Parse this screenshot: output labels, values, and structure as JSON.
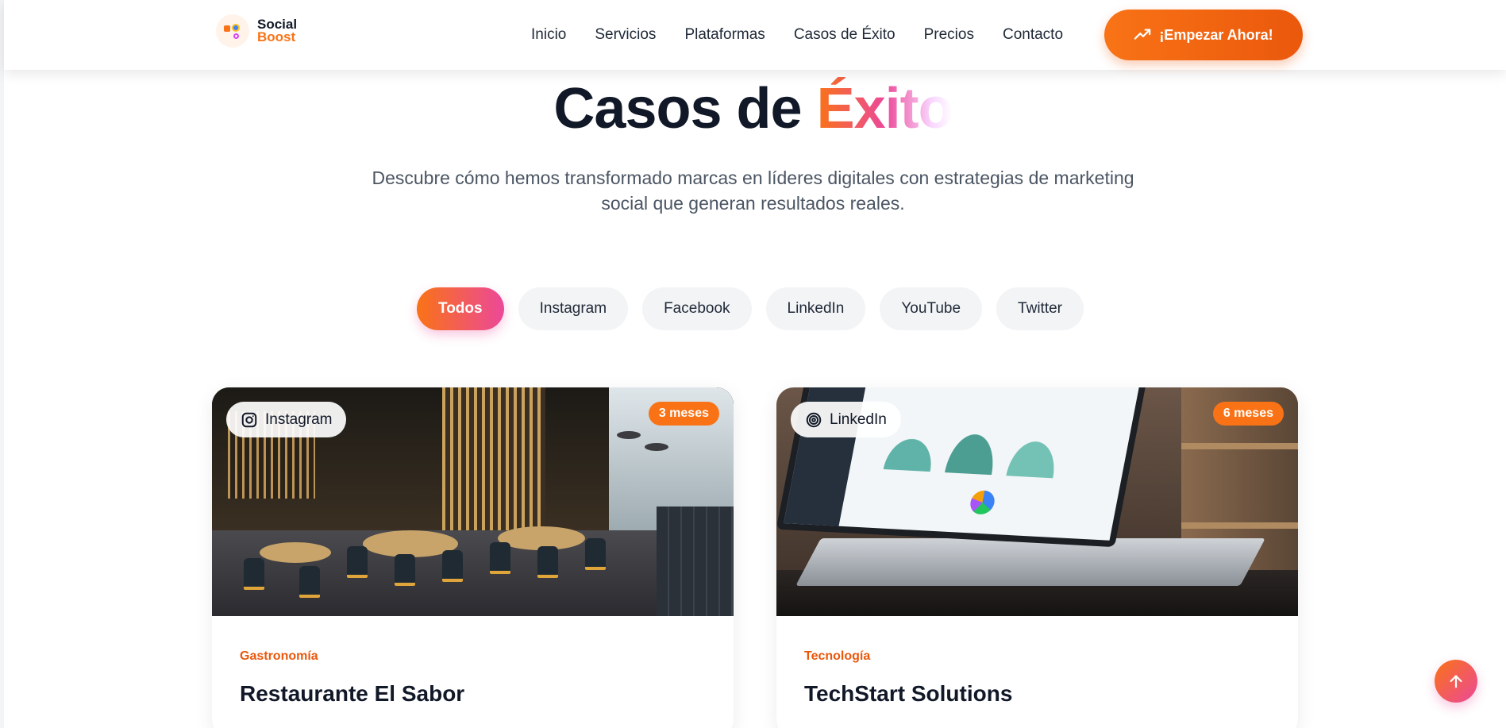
{
  "header": {
    "logo": {
      "line1": "Social",
      "line2": "Boost"
    },
    "nav": [
      "Inicio",
      "Servicios",
      "Plataformas",
      "Casos de Éxito",
      "Precios",
      "Contacto"
    ],
    "cta_label": "¡Empezar Ahora!"
  },
  "hero": {
    "title_prefix": "Casos de",
    "title_highlight": "Éxito",
    "subtitle": "Descubre cómo hemos transformado marcas en líderes digitales con estrategias de marketing social que generan resultados reales."
  },
  "filters": {
    "active": "Todos",
    "items": [
      "Todos",
      "Instagram",
      "Facebook",
      "LinkedIn",
      "YouTube",
      "Twitter"
    ]
  },
  "cases": [
    {
      "platform": "Instagram",
      "platform_icon": "instagram-icon",
      "duration": "3 meses",
      "category": "Gastronomía",
      "title": "Restaurante El Sabor"
    },
    {
      "platform": "LinkedIn",
      "platform_icon": "target-icon",
      "duration": "6 meses",
      "category": "Tecnología",
      "title": "TechStart Solutions"
    }
  ],
  "colors": {
    "accent": "#f97316",
    "gradient_end": "#ec4899",
    "text_dark": "#111827",
    "text_muted": "#4b5563",
    "chip_bg": "#f3f4f6"
  },
  "icons": {
    "cta": "trending-up-icon",
    "scroll_top": "arrow-up-icon"
  }
}
